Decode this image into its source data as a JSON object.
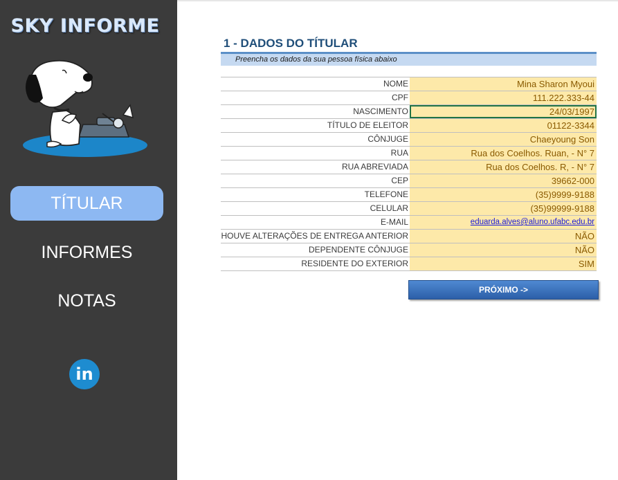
{
  "sidebar": {
    "brand": "SKY INFORME",
    "nav": [
      {
        "label": "TÍTULAR",
        "active": true
      },
      {
        "label": "INFORMES",
        "active": false
      },
      {
        "label": "NOTAS",
        "active": false
      }
    ],
    "linkedin_icon": "linkedin-icon",
    "linkedin_text": "in"
  },
  "main": {
    "title": "1 - DADOS DO TÍTULAR",
    "subtitle": "Preencha os dados da sua pessoa física abaixo",
    "fields": [
      {
        "label": "NOME",
        "value": "Mina Sharon Myoui"
      },
      {
        "label": "CPF",
        "value": "111.222.333-44"
      },
      {
        "label": "NASCIMENTO",
        "value": "24/03/1997"
      },
      {
        "label": "TÍTULO DE ELEITOR",
        "value": "01122-3344"
      },
      {
        "label": "CÔNJUGE",
        "value": "Chaeyoung Son"
      },
      {
        "label": "RUA",
        "value": "Rua dos Coelhos. Ruan, - N° 7"
      },
      {
        "label": "RUA ABREVIADA",
        "value": "Rua dos Coelhos. R, - N° 7"
      },
      {
        "label": "CEP",
        "value": "39662-000"
      },
      {
        "label": "TELEFONE",
        "value": "(35)9999-9188"
      },
      {
        "label": "CELULAR",
        "value": "(35)99999-9188"
      },
      {
        "label": "E-MAIL",
        "value": "eduarda.alves@aluno.ufabc.edu.br"
      },
      {
        "label": "HOUVE ALTERAÇÕES DE ENTREGA ANTERIOR",
        "value": "NÃO"
      },
      {
        "label": "DEPENDENTE CÔNJUGE",
        "value": "NÃO"
      },
      {
        "label": "RESIDENTE DO EXTERIOR",
        "value": "SIM"
      }
    ],
    "next_button": "PRÓXIMO ->"
  },
  "colors": {
    "sidebar_bg": "#3b3b3b",
    "nav_active": "#8db8f2",
    "title": "#1f4e79",
    "field_bg": "#fde9a9",
    "field_text": "#8a5a00",
    "button": "#2c5fa8",
    "selection": "#217346"
  }
}
